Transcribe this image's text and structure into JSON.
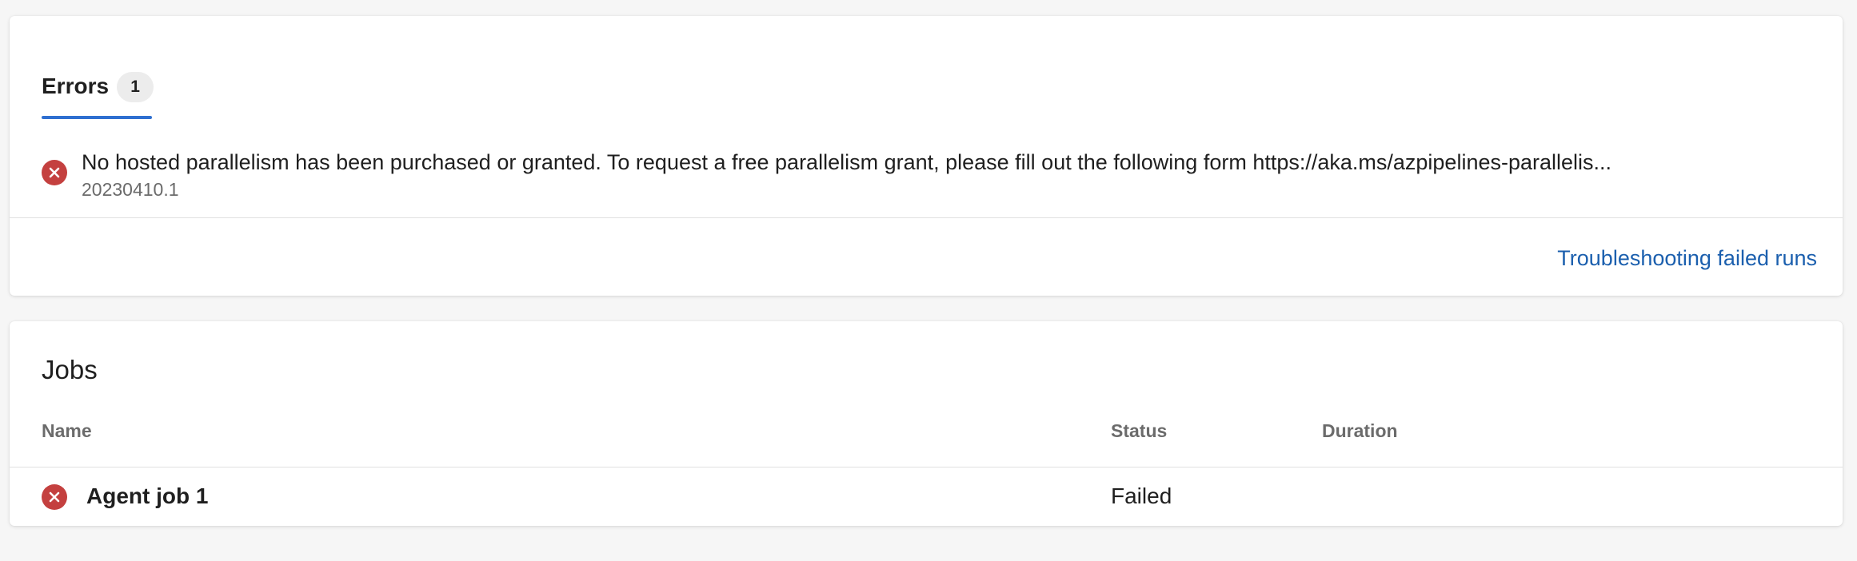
{
  "errors": {
    "tab_label": "Errors",
    "count": "1",
    "items": [
      {
        "message": "No hosted parallelism has been purchased or granted. To request a free parallelism grant, please fill out the following form https://aka.ms/azpipelines-parallelis...",
        "sub": "20230410.1",
        "icon": "error-circle-icon"
      }
    ],
    "troubleshooting_link": "Troubleshooting failed runs"
  },
  "jobs": {
    "title": "Jobs",
    "columns": {
      "name": "Name",
      "status": "Status",
      "duration": "Duration"
    },
    "rows": [
      {
        "name": "Agent job 1",
        "status": "Failed",
        "duration": "",
        "icon": "error-circle-icon"
      }
    ]
  },
  "colors": {
    "accent": "#2f6fd0",
    "link": "#1b5fae",
    "error": "#c4403f"
  }
}
